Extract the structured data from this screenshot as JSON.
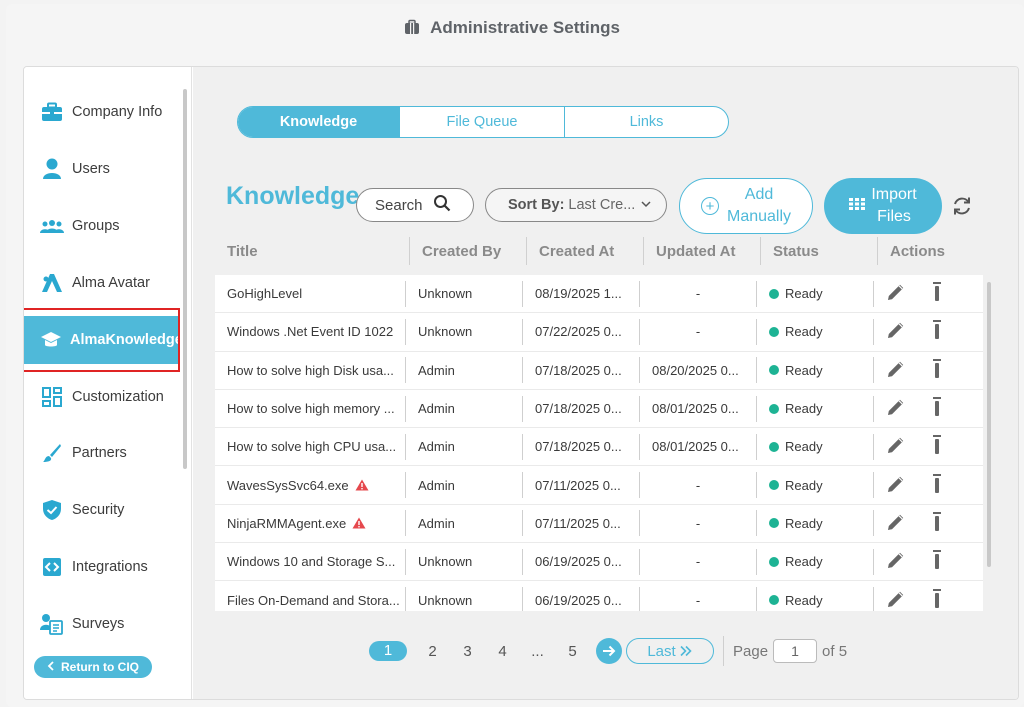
{
  "header": {
    "title": "Administrative Settings",
    "icon": "briefcase-icon"
  },
  "sidebar": {
    "items": [
      {
        "label": "Company Info",
        "icon": "briefcase-icon"
      },
      {
        "label": "Users",
        "icon": "user-icon"
      },
      {
        "label": "Groups",
        "icon": "group-icon"
      },
      {
        "label": "Alma Avatar",
        "icon": "avatar-a-icon"
      },
      {
        "label": "AlmaKnowledge",
        "icon": "graduation-cap-icon",
        "active": true
      },
      {
        "label": "Customization",
        "icon": "dashboard-grid-icon"
      },
      {
        "label": "Partners",
        "icon": "brush-icon"
      },
      {
        "label": "Security",
        "icon": "shield-check-icon"
      },
      {
        "label": "Integrations",
        "icon": "code-box-icon"
      },
      {
        "label": "Surveys",
        "icon": "survey-icon"
      }
    ],
    "return_label": "Return to CIQ"
  },
  "tabs": [
    {
      "label": "Knowledge",
      "active": true
    },
    {
      "label": "File Queue"
    },
    {
      "label": "Links"
    }
  ],
  "toolbar": {
    "title": "Knowledge",
    "search_label": "Search",
    "sort_prefix": "Sort By:",
    "sort_value": "Last Cre...",
    "add_line1": "Add",
    "add_line2": "Manually",
    "import_line1": "Import",
    "import_line2": "Files"
  },
  "table": {
    "columns": [
      "Title",
      "Created By",
      "Created At",
      "Updated At",
      "Status",
      "Actions"
    ],
    "rows": [
      {
        "title": "GoHighLevel",
        "created_by": "Unknown",
        "created_at": "08/19/2025 1...",
        "updated_at": "-",
        "status": "Ready",
        "warn": false
      },
      {
        "title": "Windows .Net Event ID 1022",
        "created_by": "Unknown",
        "created_at": "07/22/2025 0...",
        "updated_at": "-",
        "status": "Ready",
        "warn": false
      },
      {
        "title": "How to solve high Disk usa...",
        "created_by": "Admin",
        "created_at": "07/18/2025 0...",
        "updated_at": "08/20/2025 0...",
        "status": "Ready",
        "warn": false
      },
      {
        "title": "How to solve high memory ...",
        "created_by": "Admin",
        "created_at": "07/18/2025 0...",
        "updated_at": "08/01/2025 0...",
        "status": "Ready",
        "warn": false
      },
      {
        "title": "How to solve high CPU usa...",
        "created_by": "Admin",
        "created_at": "07/18/2025 0...",
        "updated_at": "08/01/2025 0...",
        "status": "Ready",
        "warn": false
      },
      {
        "title": "WavesSysSvc64.exe",
        "created_by": "Admin",
        "created_at": "07/11/2025 0...",
        "updated_at": "-",
        "status": "Ready",
        "warn": true
      },
      {
        "title": "NinjaRMMAgent.exe",
        "created_by": "Admin",
        "created_at": "07/11/2025 0...",
        "updated_at": "-",
        "status": "Ready",
        "warn": true
      },
      {
        "title": "Windows 10 and Storage S...",
        "created_by": "Unknown",
        "created_at": "06/19/2025 0...",
        "updated_at": "-",
        "status": "Ready",
        "warn": false
      },
      {
        "title": "Files On-Demand and Stora...",
        "created_by": "Unknown",
        "created_at": "06/19/2025 0...",
        "updated_at": "-",
        "status": "Ready",
        "warn": false
      }
    ]
  },
  "pagination": {
    "pages": [
      "1",
      "2",
      "3",
      "4",
      "...",
      "5"
    ],
    "current": "1",
    "last_label": "Last",
    "page_label": "Page",
    "page_value": "1",
    "of_label": "of 5"
  },
  "colors": {
    "accent": "#4fb9d9",
    "ready": "#1db394",
    "warning": "#e5484d",
    "highlight": "#e02424"
  }
}
